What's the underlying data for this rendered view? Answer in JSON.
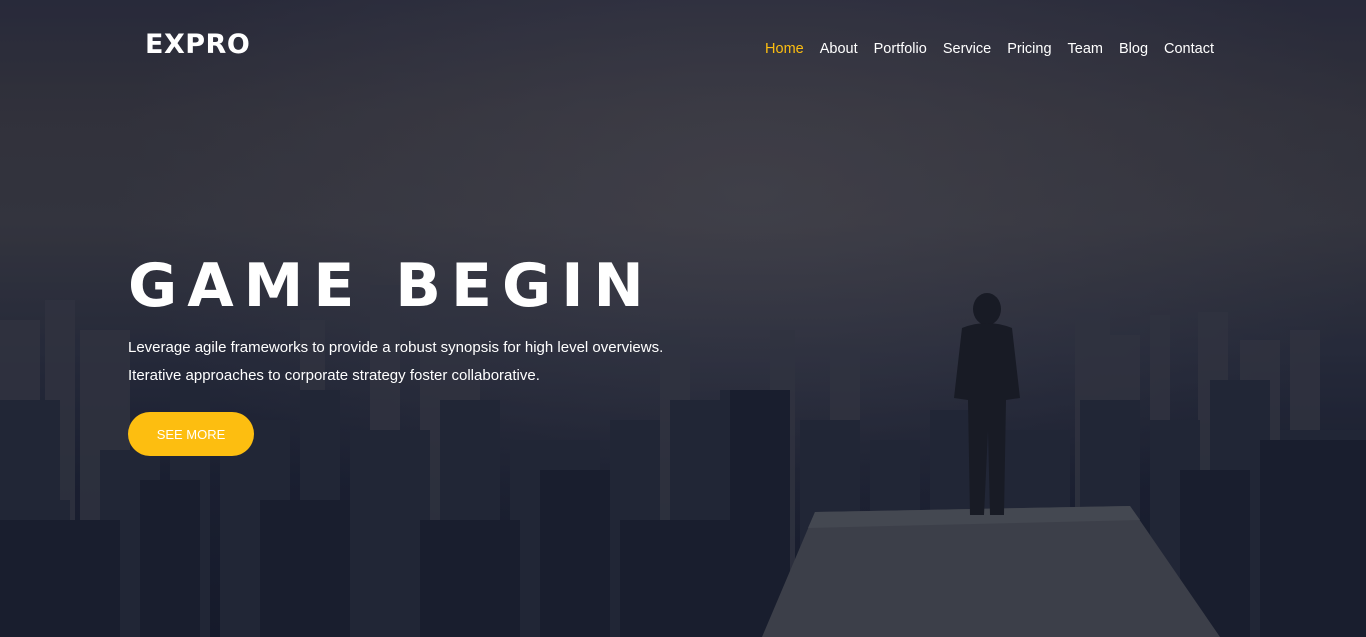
{
  "brand": {
    "logo_text": "EXPRO"
  },
  "nav": {
    "items": [
      {
        "label": "Home",
        "active": true
      },
      {
        "label": "About",
        "active": false
      },
      {
        "label": "Portfolio",
        "active": false
      },
      {
        "label": "Service",
        "active": false
      },
      {
        "label": "Pricing",
        "active": false
      },
      {
        "label": "Team",
        "active": false
      },
      {
        "label": "Blog",
        "active": false
      },
      {
        "label": "Contact",
        "active": false
      }
    ]
  },
  "hero": {
    "title": "GAME BEGIN",
    "lines": [
      "Leverage agile frameworks to provide a robust synopsis for high level overviews.",
      "Iterative approaches to corporate strategy foster collaborative."
    ],
    "cta_label": "SEE MORE"
  },
  "colors": {
    "accent": "#fdbe10",
    "text": "#ffffff",
    "background_dark": "#161b2c"
  }
}
